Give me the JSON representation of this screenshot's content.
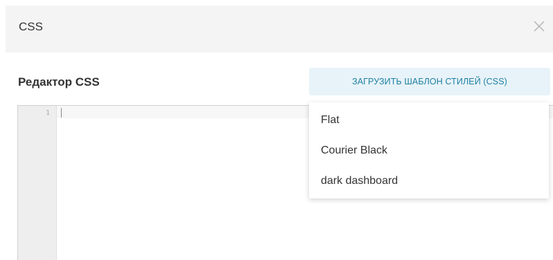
{
  "dialog": {
    "title": "CSS",
    "close_icon": "close-icon"
  },
  "editor": {
    "label": "Редактор CSS",
    "line_numbers": [
      "1"
    ],
    "content": ""
  },
  "load_template_button": {
    "label": "ЗАГРУЗИТЬ ШАБЛОН СТИЛЕЙ (CSS)"
  },
  "template_dropdown": {
    "items": [
      "Flat",
      "Courier Black",
      "dark dashboard"
    ]
  },
  "colors": {
    "header_bg": "#f4f4f4",
    "button_bg": "#e7f3f8",
    "button_text": "#1e7fa3",
    "gutter_bg": "#eeeeee"
  }
}
